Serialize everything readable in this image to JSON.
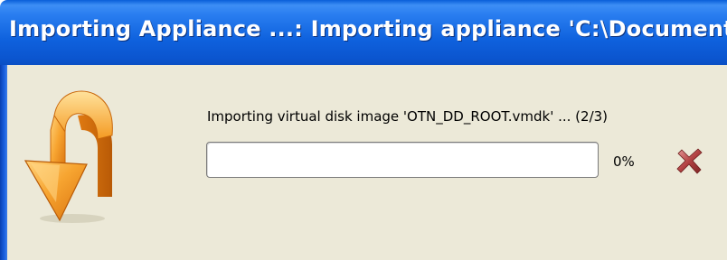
{
  "window": {
    "title": "Importing Appliance ...: Importing appliance 'C:\\Documents ..."
  },
  "progress": {
    "status_text": "Importing virtual disk image 'OTN_DD_ROOT.vmdk' ... (2/3)",
    "percent_label": "0%",
    "value_fraction": 0.0
  },
  "icons": {
    "main_icon": "import-arrow-icon",
    "cancel_icon": "cancel-x-icon"
  },
  "colors": {
    "titlebar": "#0b55cf",
    "dialog_background": "#ece9d8",
    "arrow_orange": "#f39a1e",
    "cancel_red": "#a83a3a"
  }
}
